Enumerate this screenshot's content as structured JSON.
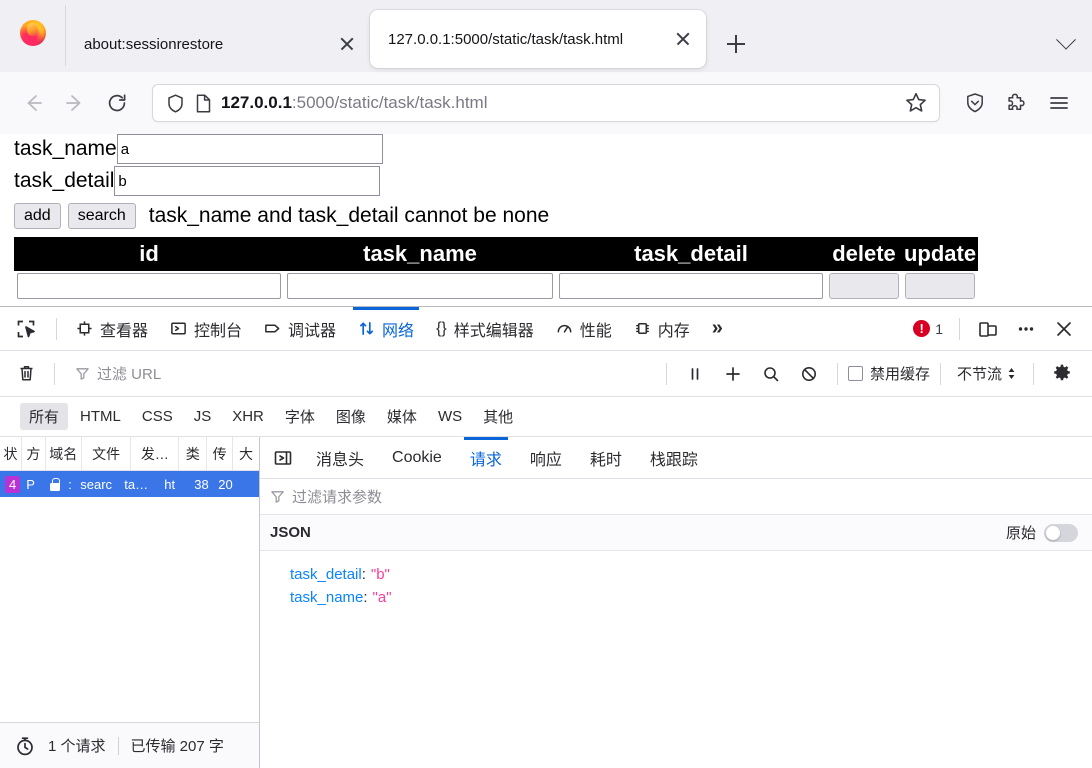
{
  "browser": {
    "tabs": [
      {
        "title": "about:sessionrestore",
        "active": false,
        "close_icon": "close-icon"
      },
      {
        "title": "127.0.0.1:5000/static/task/task.html",
        "active": true,
        "close_icon": "close-icon"
      }
    ],
    "new_tab_label": "+",
    "list_all_tabs_icon": "chevron-down-icon",
    "nav": {
      "back_icon": "arrow-left-icon",
      "forward_icon": "arrow-right-icon",
      "reload_icon": "reload-icon",
      "shield_icon": "shield-icon",
      "page_icon": "page-icon",
      "url_host": "127.0.0.1",
      "url_rest": ":5000/static/task/task.html",
      "bookmark_icon": "star-icon",
      "downloads_icon": "downloads-shield-icon",
      "extensions_icon": "extensions-puzzle-icon",
      "menu_icon": "hamburger-menu-icon"
    }
  },
  "page": {
    "fields": [
      {
        "label": "task_name",
        "value": "a"
      },
      {
        "label": "task_detail",
        "value": "b"
      }
    ],
    "buttons": [
      {
        "label": "add"
      },
      {
        "label": "search"
      }
    ],
    "message": "task_name and task_detail cannot be none",
    "table": {
      "headers": [
        "id",
        "task_name",
        "task_detail",
        "delete",
        "update"
      ]
    }
  },
  "devtools": {
    "picker_icon": "element-picker-icon",
    "tabs": [
      {
        "label": "查看器",
        "icon": "inspector-icon",
        "active": false
      },
      {
        "label": "控制台",
        "icon": "console-icon",
        "active": false
      },
      {
        "label": "调试器",
        "icon": "debugger-icon",
        "active": false
      },
      {
        "label": "网络",
        "icon": "network-icon",
        "active": true
      },
      {
        "label": "样式编辑器",
        "icon": "style-editor-icon",
        "active": false
      },
      {
        "label": "性能",
        "icon": "performance-icon",
        "active": false
      },
      {
        "label": "内存",
        "icon": "memory-icon",
        "active": false
      },
      {
        "label": "»",
        "icon": "more-tabs-icon",
        "active": false
      }
    ],
    "error_count": "1",
    "responsive_icon": "responsive-design-icon",
    "meatball_icon": "more-options-icon",
    "close_icon": "close-icon",
    "network_toolbar": {
      "clear_icon": "trash-icon",
      "filter_icon": "funnel-icon",
      "filter_placeholder": "过滤 URL",
      "pause_icon": "pause-icon",
      "plus_icon": "plus-icon",
      "search_icon": "search-icon",
      "block_icon": "block-icon",
      "disable_cache_label": "禁用缓存",
      "throttle_label": "不节流",
      "settings_icon": "gear-icon"
    },
    "type_filters": [
      {
        "label": "所有",
        "active": true
      },
      {
        "label": "HTML",
        "active": false
      },
      {
        "label": "CSS",
        "active": false
      },
      {
        "label": "JS",
        "active": false
      },
      {
        "label": "XHR",
        "active": false
      },
      {
        "label": "字体",
        "active": false
      },
      {
        "label": "图像",
        "active": false
      },
      {
        "label": "媒体",
        "active": false
      },
      {
        "label": "WS",
        "active": false
      },
      {
        "label": "其他",
        "active": false
      }
    ],
    "request_columns": [
      "状",
      "方",
      "域名",
      "文件",
      "发…",
      "类",
      "传",
      "大"
    ],
    "requests": [
      {
        "status": "4",
        "method": "P",
        "secure_icon": "lock-icon",
        "domain": ":",
        "file": "searc",
        "initiator": "ta…",
        "type": "ht",
        "transferred": "38",
        "size": "20"
      }
    ],
    "status_bar": {
      "timer_icon": "stopwatch-icon",
      "request_count": "1 个请求",
      "transferred": "已传输 207 字"
    },
    "detail": {
      "play_icon": "open-panel-icon",
      "tabs": [
        {
          "label": "消息头",
          "active": false
        },
        {
          "label": "Cookie",
          "active": false
        },
        {
          "label": "请求",
          "active": true
        },
        {
          "label": "响应",
          "active": false
        },
        {
          "label": "耗时",
          "active": false
        },
        {
          "label": "栈跟踪",
          "active": false
        }
      ],
      "param_filter_icon": "funnel-icon",
      "param_filter_placeholder": "过滤请求参数",
      "json_section_label": "JSON",
      "raw_label": "原始",
      "json_entries": [
        {
          "key": "task_detail",
          "value": "\"b\""
        },
        {
          "key": "task_name",
          "value": "\"a\""
        }
      ]
    }
  },
  "colors": {
    "accent": "#0a65d8",
    "selected_row": "#3b76e8",
    "error": "#d70022",
    "status_404": "#b832d6",
    "json_key": "#0a84ff",
    "json_string": "#ff3b9a"
  }
}
